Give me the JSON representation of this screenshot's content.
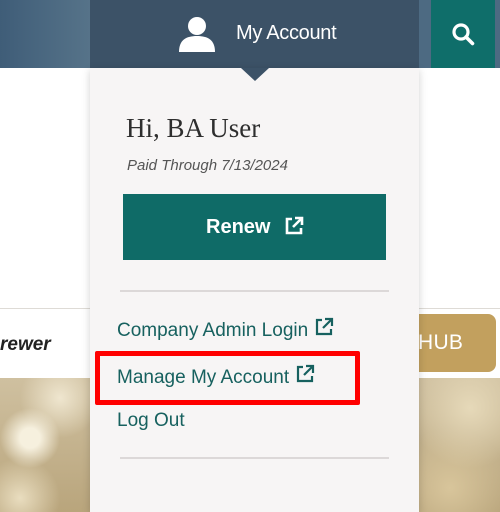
{
  "header": {
    "account_label": "My Account",
    "user_icon": "user-icon",
    "search_icon": "search-icon",
    "colors": {
      "bar": "#4d6a82",
      "account": "#3c5267",
      "search": "#0f6e6a"
    }
  },
  "page": {
    "partial_text": "rewer",
    "hub_button_label": "HUB",
    "hub_color": "#c2a05e"
  },
  "dropdown": {
    "greeting": "Hi, BA User",
    "paid_through": "Paid Through 7/13/2024",
    "renew_label": "Renew",
    "renew_color": "#0f6b67",
    "external_link_icon": "external-link-icon",
    "links": [
      {
        "label": "Company Admin Login",
        "external": true
      },
      {
        "label": "Manage My Account",
        "external": true,
        "highlighted": true
      },
      {
        "label": "Log Out",
        "external": false
      }
    ],
    "highlight_color": "#ff0000"
  }
}
